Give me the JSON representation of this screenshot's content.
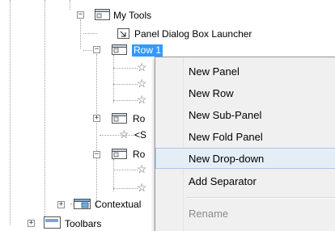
{
  "tree": {
    "my_tools": "My Tools",
    "panel_dialog_launcher": "Panel Dialog Box Launcher",
    "row1": "Row 1",
    "row_partial_a": "Ro",
    "sub_partial": "<S",
    "row_partial_b": "Ro",
    "contextual": "Contextual",
    "toolbars": "Toolbars"
  },
  "menu": {
    "items": [
      {
        "label": "New Panel"
      },
      {
        "label": "New Row"
      },
      {
        "label": "New Sub-Panel"
      },
      {
        "label": "New Fold Panel"
      },
      {
        "label": "New Drop-down"
      },
      {
        "label": "Add Separator"
      },
      {
        "label": "Rename"
      }
    ]
  },
  "colors": {
    "selection": "#3399ff",
    "menu_bg": "#f0f0f0",
    "hover_bg": "#e5eef7",
    "hover_border": "#a8c8ea"
  }
}
